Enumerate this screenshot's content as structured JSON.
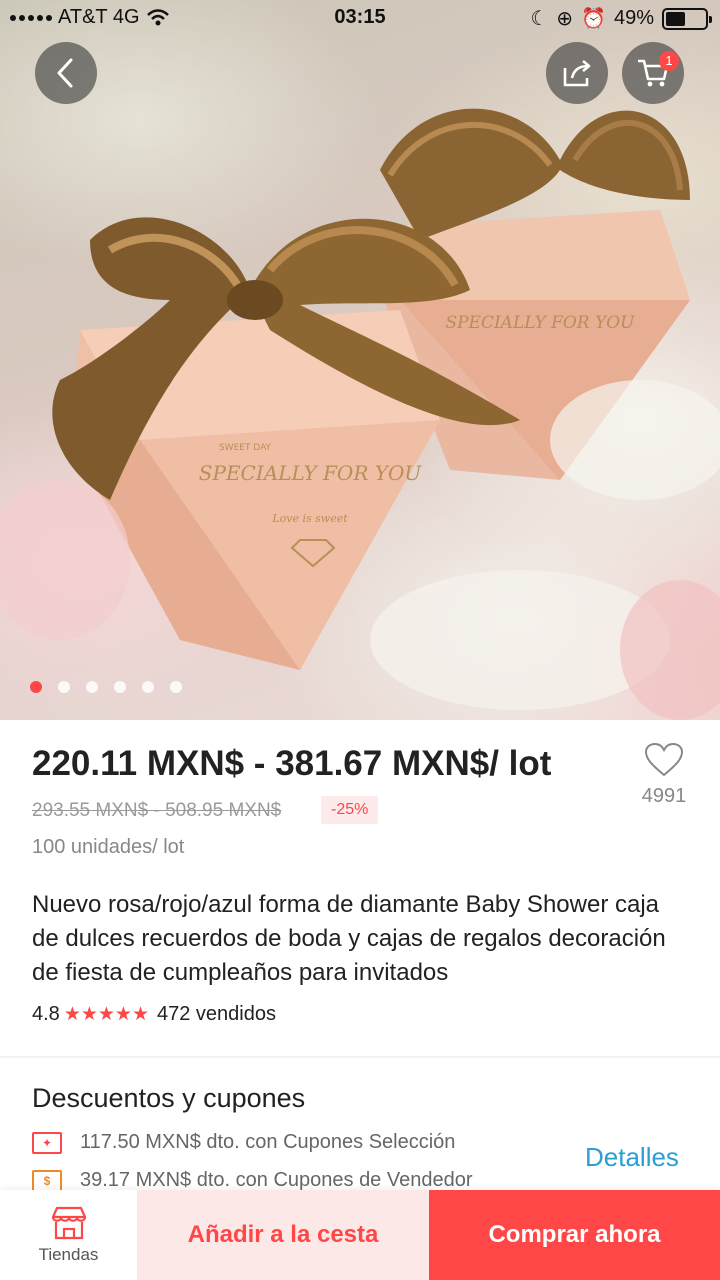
{
  "status_bar": {
    "carrier": "AT&T 4G",
    "time": "03:15",
    "battery": "49%",
    "battery_level": 0.49
  },
  "hero": {
    "image_count": 6,
    "active_index": 0
  },
  "cart": {
    "badge_count": "1"
  },
  "product": {
    "price": "220.11 MXN$ - 381.67 MXN$/ lot",
    "original_price": "293.55 MXN$ - 508.95 MXN$",
    "discount": "-25%",
    "unit": "100 unidades/ lot",
    "wishlist_count": "4991",
    "title": "Nuevo rosa/rojo/azul forma de diamante Baby Shower caja de dulces recuerdos de boda y cajas de regalos decoración de fiesta de cumpleaños para invitados",
    "rating": "4.8",
    "stars": "★★★★★",
    "sold": "472 vendidos"
  },
  "coupons": {
    "heading": "Descuentos y cupones",
    "items": [
      {
        "text": "117.50 MXN$ dto. con Cupones Selección",
        "icon": "coupon-ticket-icon"
      },
      {
        "text": "39.17 MXN$ dto. con Cupones de Vendedor",
        "icon": "seller-coupon-icon"
      }
    ],
    "details_label": "Detalles"
  },
  "bottom_bar": {
    "stores_label": "Tiendas",
    "add_to_cart_label": "Añadir a la cesta",
    "buy_now_label": "Comprar ahora"
  },
  "colors": {
    "accent": "#ff4747",
    "link": "#2a9fd6"
  }
}
